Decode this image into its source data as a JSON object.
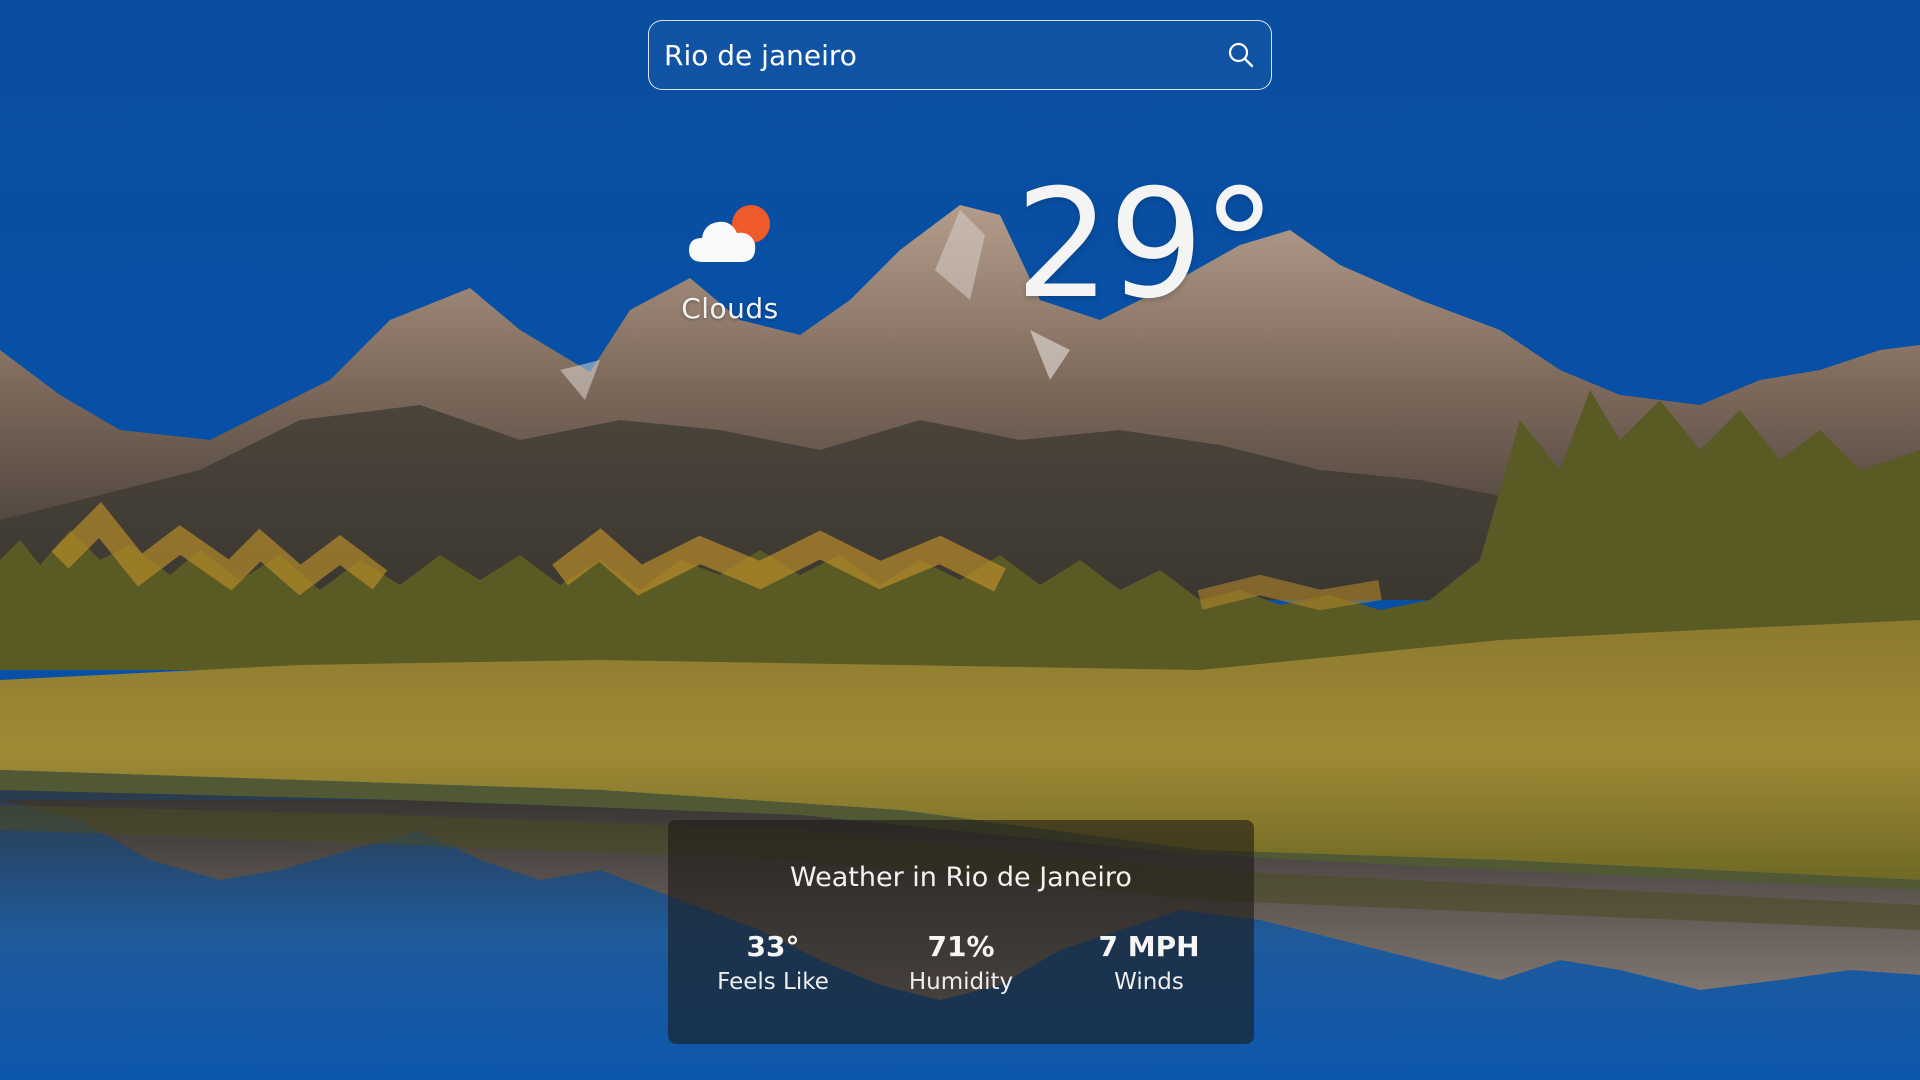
{
  "search": {
    "value": "Rio de janeiro",
    "icon": "search-icon"
  },
  "current": {
    "condition": "Clouds",
    "condition_icon": "cloud-sun-icon",
    "temperature": "29°"
  },
  "details": {
    "title": "Weather in Rio de Janeiro",
    "stats": [
      {
        "value": "33°",
        "label": "Feels Like"
      },
      {
        "value": "71%",
        "label": "Humidity"
      },
      {
        "value": "7 MPH",
        "label": "Winds"
      }
    ]
  },
  "colors": {
    "sky": "#0b4fa0",
    "sun": "#ee5a2c",
    "panel": "#1c1814"
  }
}
